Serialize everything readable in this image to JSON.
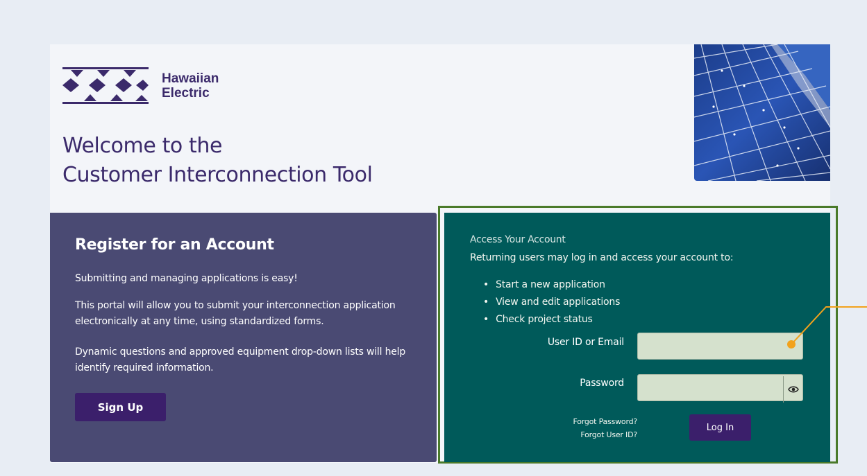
{
  "brand": {
    "logo_line1": "Hawaiian",
    "logo_line2": "Electric",
    "logo_color": "#3b2a6b"
  },
  "header": {
    "welcome_line1": "Welcome to the",
    "welcome_line2": "Customer Interconnection Tool"
  },
  "register": {
    "title": "Register for an Account",
    "p1": "Submitting and managing applications is easy!",
    "p2": "This portal will allow you to submit your interconnection application electronically at any time, using standardized forms.",
    "p3": "Dynamic questions and approved equipment drop-down lists will help identify required information.",
    "signup_label": "Sign Up",
    "bg_color": "#4a4a73"
  },
  "access": {
    "caption": "Access Your Account",
    "intro": "Returning users may log in and access your account to:",
    "bullets": [
      "Start a new application",
      "View and edit applications",
      "Check project status"
    ],
    "user_label": "User ID or Email",
    "user_value": "",
    "password_label": "Password",
    "password_value": "",
    "forgot_password": "Forgot Password?",
    "forgot_user": "Forgot User ID?",
    "login_label": "Log In",
    "bg_color": "#005a5a",
    "field_color": "#d5e1cd",
    "button_color": "#3b1f6b",
    "outline_color": "#4a7a2a"
  },
  "annotation": {
    "marker_color": "#f2a21c"
  }
}
